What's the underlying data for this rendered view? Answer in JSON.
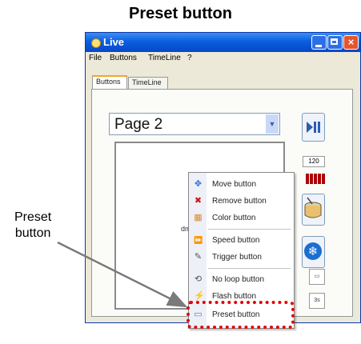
{
  "figure": {
    "title": "Preset button",
    "callout_line1": "Preset",
    "callout_line2": "button"
  },
  "window": {
    "title": "Live",
    "close_glyph": "×"
  },
  "menubar": {
    "items": [
      "File",
      "Buttons",
      "TimeLine",
      "?"
    ]
  },
  "tabs": [
    {
      "label": "Buttons",
      "active": true
    },
    {
      "label": "TimeLine",
      "active": false
    }
  ],
  "page_select": {
    "value": "Page  2",
    "arrow": "▼"
  },
  "pad": {
    "partial_text": "dm"
  },
  "side_panel": {
    "bpm": "120",
    "small_btn_1": "▭",
    "small_btn_2": "3s"
  },
  "context_menu": {
    "items": [
      {
        "label": "Move button",
        "icon": "move-icon",
        "glyph": "✥",
        "color": "#2a6fd6"
      },
      {
        "label": "Remove button",
        "icon": "remove-icon",
        "glyph": "✖",
        "color": "#d01818"
      },
      {
        "label": "Color button",
        "icon": "color-icon",
        "glyph": "▦",
        "color": "#e08a1e"
      },
      {
        "label": "Speed button",
        "icon": "speed-icon",
        "glyph": "⏩",
        "color": "#111111"
      },
      {
        "label": "Trigger button",
        "icon": "trigger-icon",
        "glyph": "✎",
        "color": "#555555"
      },
      {
        "label": "No loop button",
        "icon": "no-loop-icon",
        "glyph": "⟲",
        "color": "#555555"
      },
      {
        "label": "Flash button",
        "icon": "flash-icon",
        "glyph": "⚡",
        "color": "#555555"
      },
      {
        "label": "Preset button",
        "icon": "preset-icon",
        "glyph": "▭",
        "color": "#4a7ac8"
      }
    ]
  },
  "colors": {
    "titlebar": "#0a5fe0",
    "highlight": "#e20000",
    "accent_tab": "#f5a623"
  }
}
